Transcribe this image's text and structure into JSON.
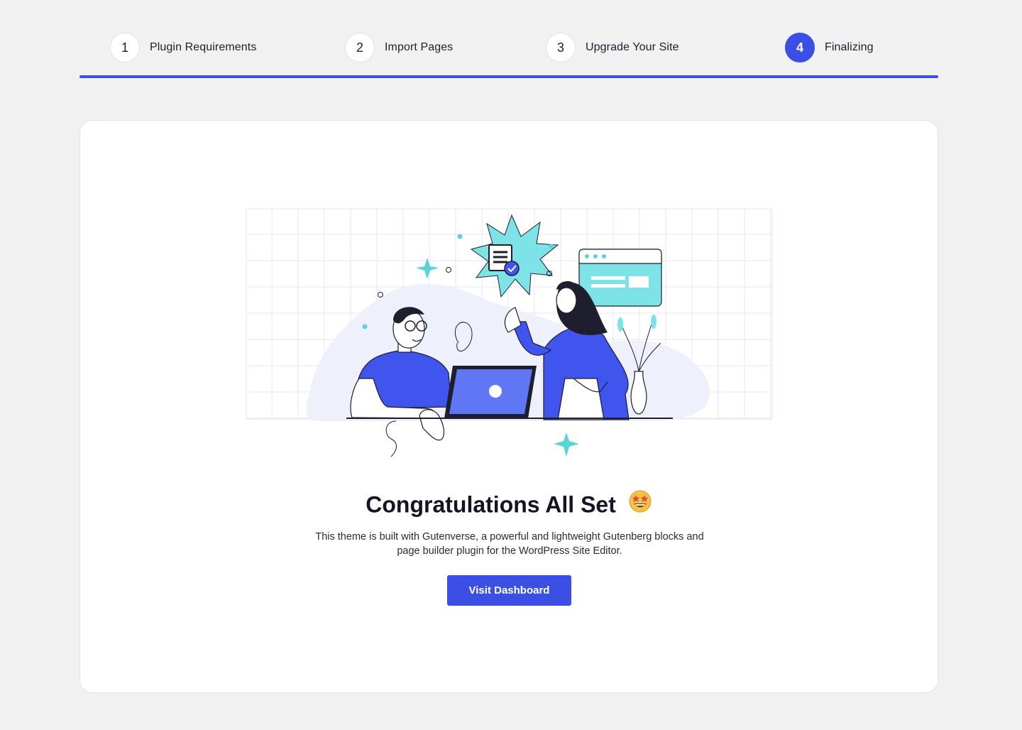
{
  "stepper": {
    "steps": [
      {
        "number": "1",
        "label": "Plugin Requirements"
      },
      {
        "number": "2",
        "label": "Import Pages"
      },
      {
        "number": "3",
        "label": "Upgrade Your Site"
      },
      {
        "number": "4",
        "label": "Finalizing"
      }
    ],
    "active_step": 4,
    "progress_percent": 100
  },
  "main": {
    "illustration_icon": "team-celebration-illustration",
    "title": "Congratulations All Set",
    "title_emoji_icon": "star-struck-emoji-icon",
    "description": "This theme is built with Gutenverse, a powerful and lightweight Gutenberg blocks and page builder plugin for the WordPress Site Editor.",
    "button_label": "Visit Dashboard"
  },
  "colors": {
    "accent": "#3b4fe4",
    "background": "#f1f1f1",
    "card": "#ffffff",
    "illustration_teal": "#6fe0e3",
    "illustration_blue": "#3f55ee"
  }
}
